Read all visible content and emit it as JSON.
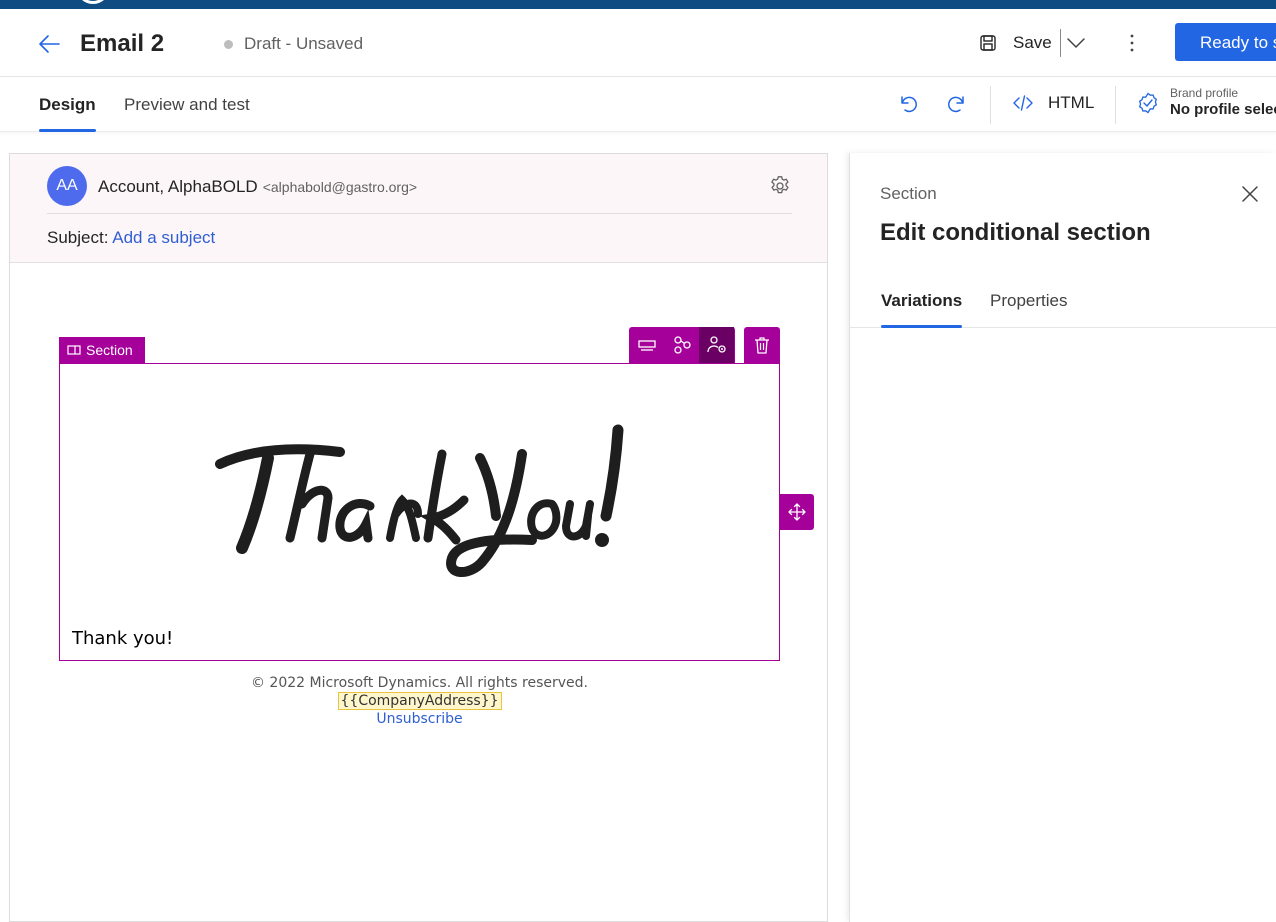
{
  "header": {
    "title": "Email 2",
    "status": "Draft - Unsaved",
    "save_label": "Save",
    "ready_label": "Ready to s"
  },
  "tabs": {
    "design": "Design",
    "preview": "Preview and test"
  },
  "toolbar": {
    "html_label": "HTML",
    "brand_small": "Brand profile",
    "brand_value": "No profile select"
  },
  "email": {
    "avatar_initials": "AA",
    "from_name": "Account, AlphaBOLD",
    "from_email": "<alphabold@gastro.org>",
    "subject_label": "Subject:",
    "subject_placeholder": "Add a subject"
  },
  "section": {
    "tag_label": "Section",
    "body_text": "Thank you!"
  },
  "footer": {
    "copyright": "© 2022 Microsoft Dynamics. All rights reserved.",
    "company_address": "{{CompanyAddress}}",
    "unsubscribe": "Unsubscribe"
  },
  "panel": {
    "label": "Section",
    "title": "Edit conditional section",
    "tabs": [
      "Variations",
      "Properties"
    ]
  },
  "colors": {
    "accent": "#2266e3",
    "section_magenta": "#a6009b",
    "topbar": "#0f4c81",
    "avatar": "#4f6bed"
  },
  "icons": {
    "back": "arrow-left-icon",
    "save": "save-icon",
    "undo": "undo-icon",
    "redo": "redo-icon",
    "html": "code-icon",
    "brand": "badge-check-icon",
    "settings": "gear-icon",
    "close": "close-icon"
  }
}
